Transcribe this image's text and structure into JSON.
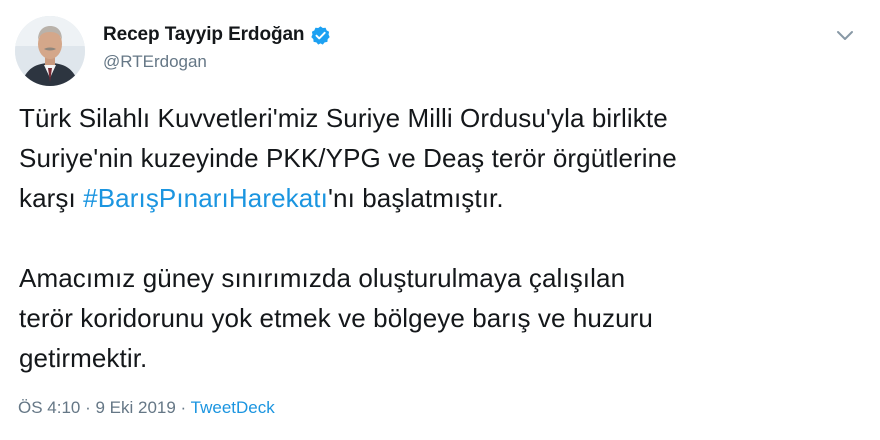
{
  "user": {
    "display_name": "Recep Tayyip Erdoğan",
    "handle": "@RTErdogan",
    "verified": true,
    "avatar_icon": "profile-photo"
  },
  "tweet": {
    "line1": "Türk Silahlı Kuvvetleri'miz Suriye Milli Ordusu'yla birlikte",
    "line2": "Suriye'nin kuzeyinde PKK/YPG ve Deaş terör örgütlerine",
    "line3_prefix": "karşı ",
    "hashtag": "#BarışPınarıHarekatı",
    "line3_suffix": "'nı başlatmıştır.",
    "line4": "Amacımız güney sınırımızda oluşturulmaya çalışılan",
    "line5": "terör koridorunu yok etmek ve bölgeye barış ve huzuru",
    "line6": "getirmektir."
  },
  "meta": {
    "time": "ÖS 4:10",
    "sep1": " · ",
    "date": "9 Eki 2019",
    "sep2": " · ",
    "source": "TweetDeck"
  },
  "colors": {
    "link": "#1b95e0",
    "secondary_text": "#657786",
    "primary_text": "#14171a",
    "verified_badge": "#1da1f2"
  },
  "icons": {
    "verified": "verified-badge-icon",
    "menu": "chevron-down-icon"
  }
}
